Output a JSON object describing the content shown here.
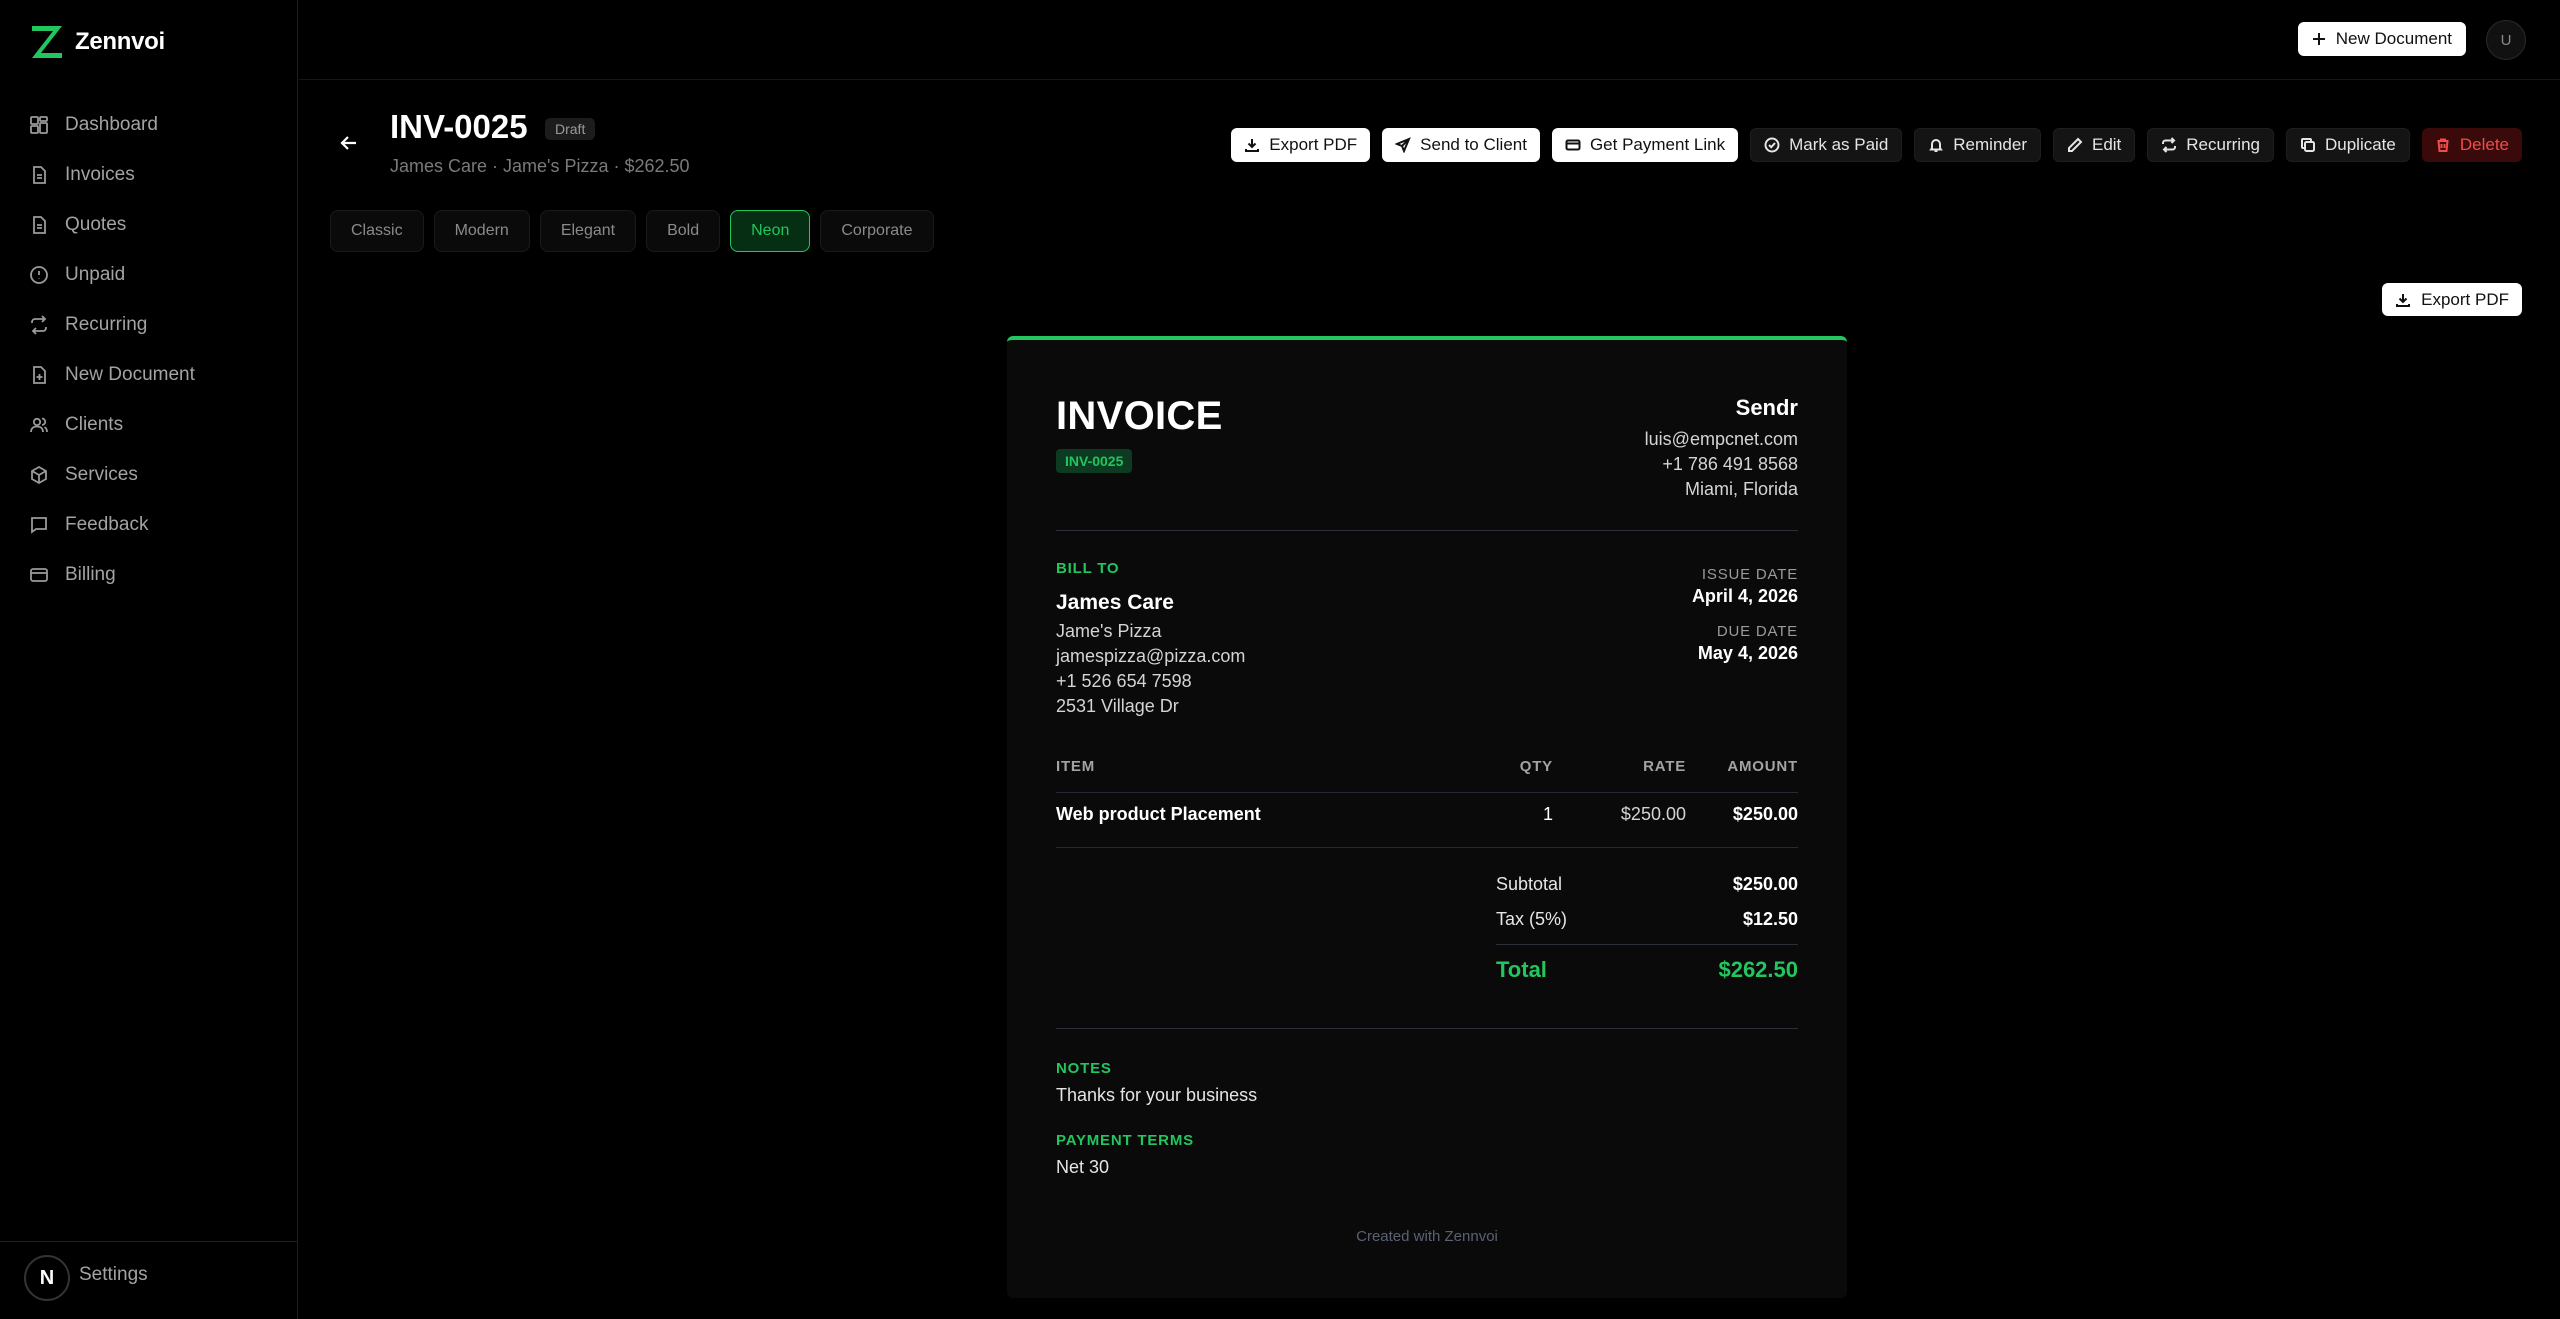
{
  "app": {
    "name": "Zennvoi"
  },
  "sidebar": {
    "items": [
      {
        "label": "Dashboard",
        "icon": "dashboard-icon"
      },
      {
        "label": "Invoices",
        "icon": "file-icon"
      },
      {
        "label": "Quotes",
        "icon": "file-icon"
      },
      {
        "label": "Unpaid",
        "icon": "alert-circle-icon"
      },
      {
        "label": "Recurring",
        "icon": "repeat-icon"
      },
      {
        "label": "New Document",
        "icon": "file-plus-icon"
      },
      {
        "label": "Clients",
        "icon": "users-icon"
      },
      {
        "label": "Services",
        "icon": "box-icon"
      },
      {
        "label": "Feedback",
        "icon": "message-icon"
      },
      {
        "label": "Billing",
        "icon": "credit-card-icon"
      }
    ],
    "settings_label": "Settings",
    "avatar_letter": "N"
  },
  "topbar": {
    "new_document_label": "New Document",
    "user_initial": "U"
  },
  "document": {
    "number": "INV-0025",
    "status": "Draft",
    "subtitle": "James Care · Jame's Pizza · $262.50"
  },
  "actions": {
    "export_pdf": "Export PDF",
    "send_to_client": "Send to Client",
    "get_payment_link": "Get Payment Link",
    "mark_as_paid": "Mark as Paid",
    "reminder": "Reminder",
    "edit": "Edit",
    "recurring": "Recurring",
    "duplicate": "Duplicate",
    "delete": "Delete"
  },
  "templates": [
    "Classic",
    "Modern",
    "Elegant",
    "Bold",
    "Neon",
    "Corporate"
  ],
  "active_template": "Neon",
  "export_pdf_right": "Export PDF",
  "invoice": {
    "heading": "INVOICE",
    "number": "INV-0025",
    "sender": {
      "name": "Sendr",
      "email": "luis@empcnet.com",
      "phone": "+1 786 491 8568",
      "location": "Miami, Florida"
    },
    "bill_to_label": "BILL TO",
    "client": {
      "name": "James Care",
      "company": "Jame's Pizza",
      "email": "jamespizza@pizza.com",
      "phone": "+1 526 654 7598",
      "address": "2531 Village Dr"
    },
    "issue_date_label": "ISSUE DATE",
    "issue_date": "April 4, 2026",
    "due_date_label": "DUE DATE",
    "due_date": "May 4, 2026",
    "columns": {
      "item": "ITEM",
      "qty": "QTY",
      "rate": "RATE",
      "amount": "AMOUNT"
    },
    "rows": [
      {
        "item": "Web product Placement",
        "qty": "1",
        "rate": "$250.00",
        "amount": "$250.00"
      }
    ],
    "subtotal_label": "Subtotal",
    "subtotal": "$250.00",
    "tax_label": "Tax (5%)",
    "tax": "$12.50",
    "total_label": "Total",
    "total": "$262.50",
    "notes_label": "NOTES",
    "notes": "Thanks for your business",
    "payment_terms_label": "PAYMENT TERMS",
    "payment_terms": "Net 30",
    "footer": "Created with Zennvoi"
  },
  "colors": {
    "accent": "#22c55e",
    "danger": "#f24b4b",
    "background": "#000000"
  }
}
